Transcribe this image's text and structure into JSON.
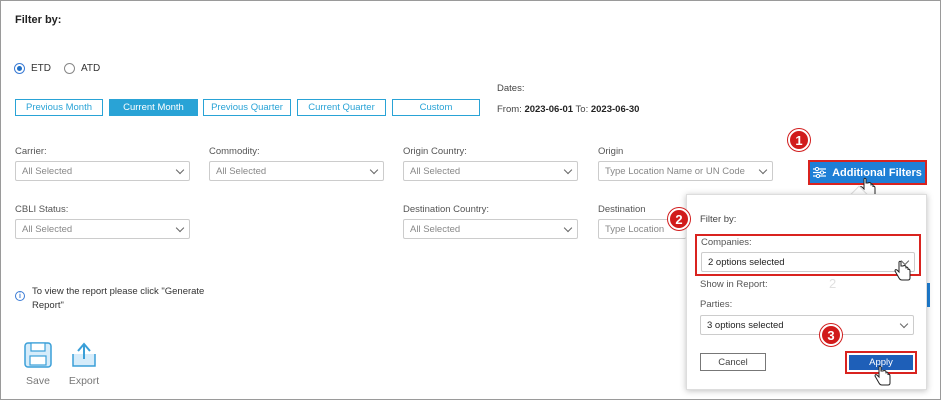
{
  "filter_title": "Filter by:",
  "date_type": {
    "options": [
      "ETD",
      "ATD"
    ],
    "selected": "ETD"
  },
  "ranges": [
    "Previous Month",
    "Current Month",
    "Previous Quarter",
    "Current Quarter",
    "Custom"
  ],
  "active_range": "Current Month",
  "dates": {
    "label": "Dates:",
    "from_label": "From:",
    "from": "2023-06-01",
    "to_label": "To:",
    "to": "2023-06-30"
  },
  "filters": {
    "carrier": {
      "label": "Carrier:",
      "value": "All Selected"
    },
    "commodity": {
      "label": "Commodity:",
      "value": "All Selected"
    },
    "origin_country": {
      "label": "Origin Country:",
      "value": "All Selected"
    },
    "origin": {
      "label": "Origin",
      "placeholder": "Type Location Name or UN Code"
    },
    "cbli_status": {
      "label": "CBLI Status:",
      "value": "All Selected"
    },
    "destination_country": {
      "label": "Destination Country:",
      "value": "All Selected"
    },
    "destination": {
      "label": "Destination",
      "placeholder": "Type Location"
    }
  },
  "additional_filters_label": "Additional Filters",
  "info_text": "To view the report please click \"Generate Report\"",
  "toolbar": {
    "save_label": "Save",
    "export_label": "Export"
  },
  "popup": {
    "title": "Filter by:",
    "companies_label": "Companies:",
    "companies_value": "2 options selected",
    "show_in_report": "Show in Report:",
    "parties_label": "Parties:",
    "parties_value": "3 options selected",
    "cancel_label": "Cancel",
    "apply_label": "Apply",
    "ghost_number": "2"
  },
  "callouts": [
    "1",
    "2",
    "3"
  ],
  "colors": {
    "primary": "#1e7fd6",
    "accent": "#29a3d6",
    "highlight": "#d9231f",
    "badge": "#d11b1b",
    "apply": "#1e5fb8"
  }
}
